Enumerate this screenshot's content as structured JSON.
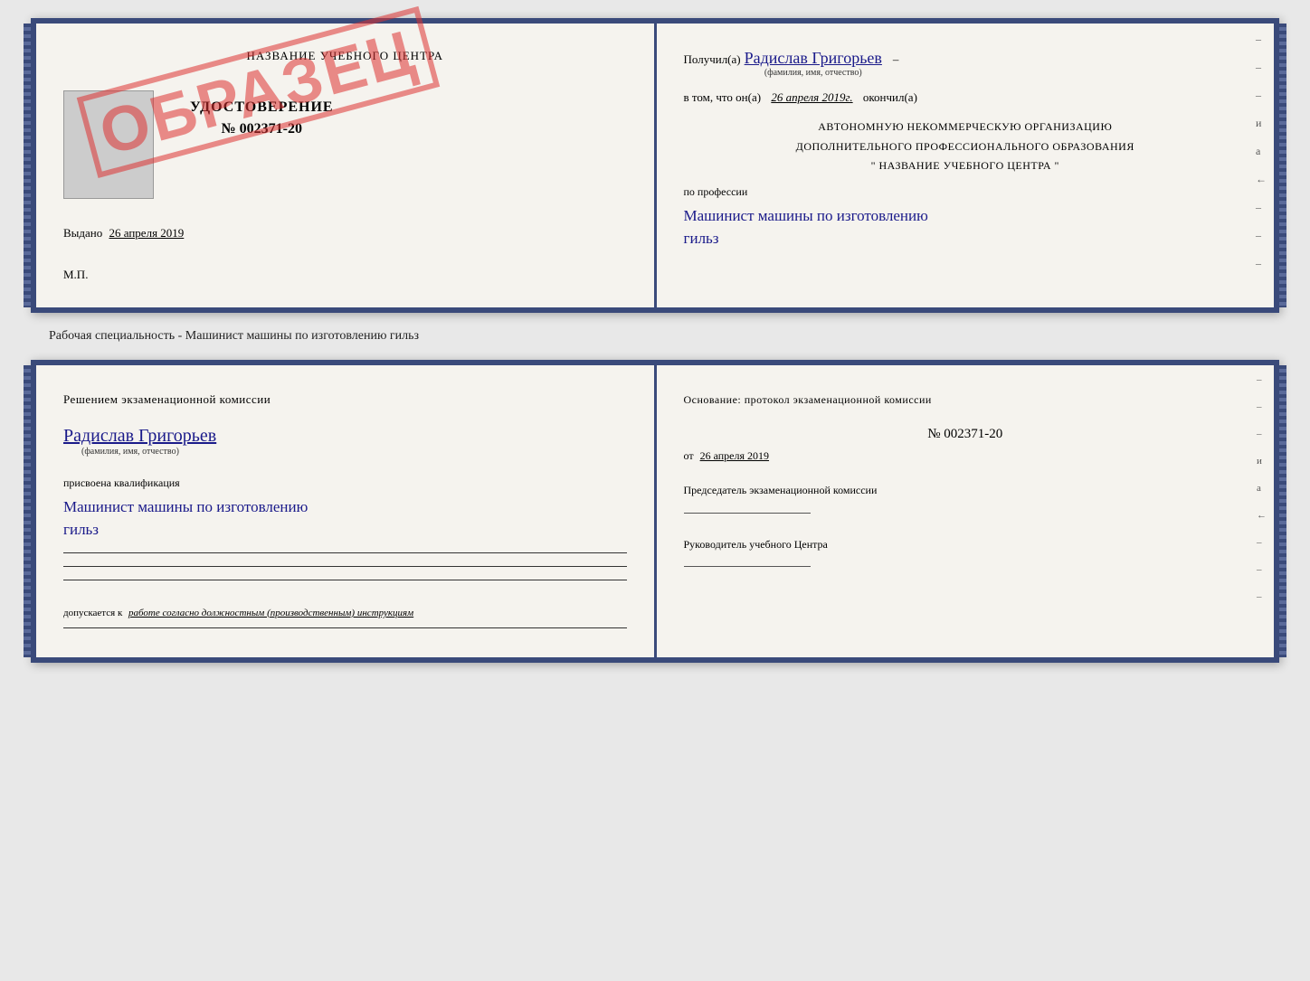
{
  "top_cert": {
    "left": {
      "title": "НАЗВАНИЕ УЧЕБНОГО ЦЕНТРА",
      "stamp_text": "ОБРАЗЕЦ",
      "udostoverenie_label": "УДОСТОВЕРЕНИЕ",
      "udostoverenie_number": "№ 002371-20",
      "vydano_prefix": "Выдано",
      "vydano_date": "26 апреля 2019",
      "mp": "М.П."
    },
    "right": {
      "poluchil_prefix": "Получил(а)",
      "poluchil_name": "Радислав Григорьев",
      "fio_label": "(фамилия, имя, отчество)",
      "dash1": "–",
      "vtom_prefix": "в том, что он(а)",
      "vtom_date": "26 апреля 2019г.",
      "okончил": "окончил(а)",
      "dash2": "–",
      "org_line1": "АВТОНОМНУЮ НЕКОММЕРЧЕСКУЮ ОРГАНИЗАЦИЮ",
      "org_line2": "ДОПОЛНИТЕЛЬНОГО ПРОФЕССИОНАЛЬНОГО ОБРАЗОВАНИЯ",
      "org_line3": "\"  НАЗВАНИЕ УЧЕБНОГО ЦЕНТРА  \"",
      "dash3": "–",
      "po_professii": "по профессии",
      "prof_name": "Машинист машины по изготовлению",
      "prof_name2": "гильз",
      "side_marks": [
        "–",
        "–",
        "–",
        "и",
        "а",
        "←",
        "–",
        "–",
        "–"
      ]
    }
  },
  "caption": "Рабочая специальность - Машинист машины по изготовлению гильз",
  "bottom_cert": {
    "left": {
      "resheniyem_title": "Решением  экзаменационной  комиссии",
      "name": "Радислав Григорьев",
      "fio_label": "(фамилия, имя, отчество)",
      "prisvoena": "присвоена квалификация",
      "kvali_name": "Машинист машины по изготовлению",
      "kvali_name2": "гильз",
      "dopuskaetsya": "допускается к",
      "dopusk_italic": "работе согласно должностным (производственным) инструкциям"
    },
    "right": {
      "osnov_label": "Основание: протокол экзаменационной  комиссии",
      "protocol_number": "№  002371-20",
      "date_prefix": "от",
      "date_value": "26 апреля 2019",
      "predsedatel_label": "Председатель экзаменационной комиссии",
      "rukovoditel_label": "Руководитель учебного Центра",
      "side_marks": [
        "–",
        "–",
        "–",
        "и",
        "а",
        "←",
        "–",
        "–",
        "–"
      ]
    }
  }
}
